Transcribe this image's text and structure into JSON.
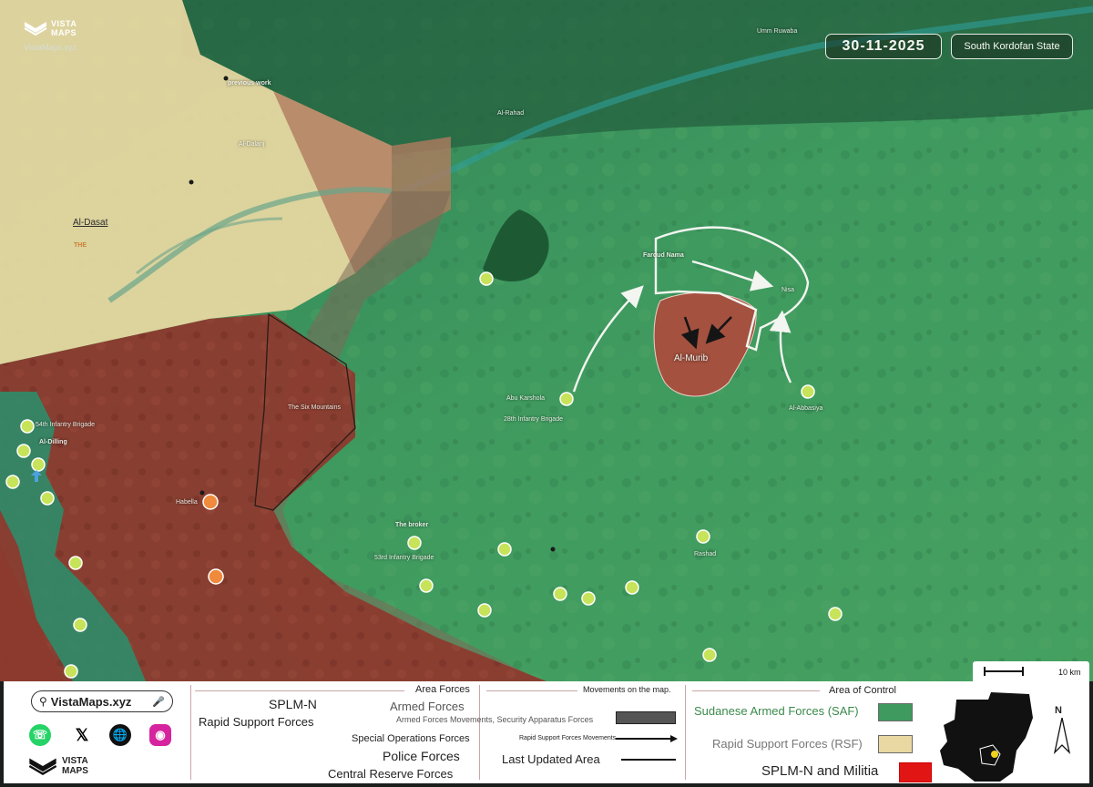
{
  "header": {
    "brand_line1": "VISTA",
    "brand_line2": "MAPS",
    "site": "VistaMaps.xyz",
    "date": "30-11-2025",
    "region": "South Kordofan State"
  },
  "map": {
    "labels": {
      "umm_ruwaba": "Umm Ruwaba",
      "previous_work": "previous work",
      "al_rahad_north": "Al-Rahad",
      "al_dalanj_plain": "Al-Dalanj",
      "al_dasat": "Al-Dasat",
      "the": "THE",
      "the_six_mountains": "The Six Mountains",
      "54th_brigade": "54th Infantry Brigade",
      "al_dilling": "Al-Dilling",
      "habella": "Habella",
      "abu_karshola": "Abu Karshola",
      "28th_brigade": "28th Infantry Brigade",
      "fardud_nama": "Fardud Nama",
      "nisa": "Nisa",
      "al_murib": "Al-Murib",
      "al_abbasiya": "Al-Abbasiya",
      "the_broker": "The broker",
      "53rd_brigade": "53rd Infantry Brigade",
      "rashad": "Rashad",
      "scale": "10 km",
      "north": "N"
    },
    "colors": {
      "saf": "#3e9a5e",
      "rsf": "#e9d8a2",
      "splm": "#8c3a2e",
      "marker_saf": "#c6e35a",
      "marker_rsf": "#f08a3c"
    }
  },
  "legend": {
    "social_site": "VistaMaps.xyz",
    "area_forces_title": "Area Forces",
    "splm_n": "SPLM-N",
    "rapid_support_forces": "Rapid Support Forces",
    "armed_forces": "Armed Forces",
    "special_operations_forces": "Special Operations Forces",
    "police_forces": "Police Forces",
    "central_reserve_forces": "Central Reserve Forces",
    "movements_title": "Movements on the map.",
    "armed_forces_movements": "Armed Forces Movements, Security Apparatus Forces",
    "rsf_movements": "Rapid Support Forces Movements",
    "last_updated_area": "Last Updated Area",
    "area_of_control_title": "Area of Control",
    "saf": "Sudanese Armed Forces (SAF)",
    "rsf": "Rapid Support Forces (RSF)",
    "splm_militia": "SPLM-N and Militia",
    "brand_line1": "VISTA",
    "brand_line2": "MAPS"
  }
}
